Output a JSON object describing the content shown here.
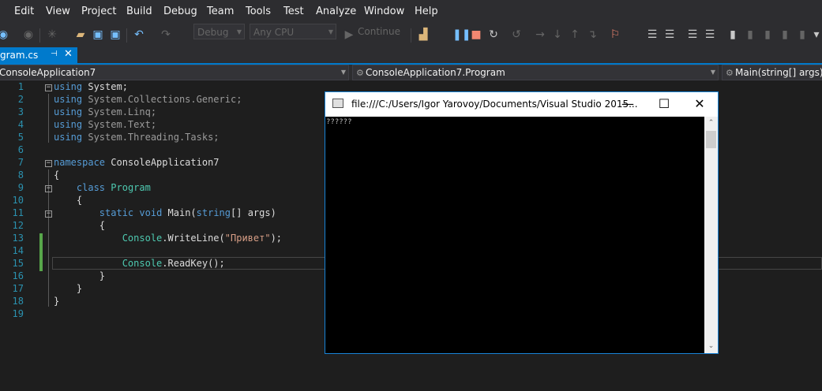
{
  "menu": [
    "Edit",
    "View",
    "Project",
    "Build",
    "Debug",
    "Team",
    "Tools",
    "Test",
    "Analyze",
    "Window",
    "Help"
  ],
  "toolbar": {
    "config": "Debug",
    "platform": "Any CPU",
    "continue_label": "Continue"
  },
  "tab": {
    "label": "gram.cs",
    "pin_icon": "pin-icon",
    "close_icon": "close-icon"
  },
  "nav": {
    "project": "ConsoleApplication7",
    "class": "ConsoleApplication7.Program",
    "member": "Main(string[] args)"
  },
  "editor": {
    "line_numbers": [
      "1",
      "2",
      "3",
      "4",
      "5",
      "6",
      "7",
      "8",
      "9",
      "10",
      "11",
      "12",
      "13",
      "14",
      "15",
      "16",
      "17",
      "18",
      "19"
    ],
    "lines": [
      {
        "indent": "",
        "tokens": [
          {
            "t": "using",
            "c": "kw"
          },
          {
            "t": " System;",
            "c": "pl"
          }
        ]
      },
      {
        "indent": "",
        "tokens": [
          {
            "t": "using",
            "c": "kw"
          },
          {
            "t": " System.Collections.Generic;",
            "c": "gray"
          }
        ]
      },
      {
        "indent": "",
        "tokens": [
          {
            "t": "using",
            "c": "kw"
          },
          {
            "t": " System.Linq;",
            "c": "gray"
          }
        ]
      },
      {
        "indent": "",
        "tokens": [
          {
            "t": "using",
            "c": "kw"
          },
          {
            "t": " System.Text;",
            "c": "gray"
          }
        ]
      },
      {
        "indent": "",
        "tokens": [
          {
            "t": "using",
            "c": "kw"
          },
          {
            "t": " System.Threading.Tasks;",
            "c": "gray"
          }
        ]
      },
      {
        "indent": "",
        "tokens": []
      },
      {
        "indent": "",
        "tokens": [
          {
            "t": "namespace",
            "c": "kw"
          },
          {
            "t": " ConsoleApplication7",
            "c": "pl"
          }
        ]
      },
      {
        "indent": "",
        "tokens": [
          {
            "t": "{",
            "c": "pl"
          }
        ]
      },
      {
        "indent": "    ",
        "tokens": [
          {
            "t": "class",
            "c": "kw"
          },
          {
            "t": " ",
            "c": "pl"
          },
          {
            "t": "Program",
            "c": "ty"
          }
        ]
      },
      {
        "indent": "    ",
        "tokens": [
          {
            "t": "{",
            "c": "pl"
          }
        ]
      },
      {
        "indent": "        ",
        "tokens": [
          {
            "t": "static",
            "c": "kw"
          },
          {
            "t": " ",
            "c": "pl"
          },
          {
            "t": "void",
            "c": "kw"
          },
          {
            "t": " Main(",
            "c": "pl"
          },
          {
            "t": "string",
            "c": "kw"
          },
          {
            "t": "[] args)",
            "c": "pl"
          }
        ]
      },
      {
        "indent": "        ",
        "tokens": [
          {
            "t": "{",
            "c": "pl"
          }
        ]
      },
      {
        "indent": "            ",
        "tokens": [
          {
            "t": "Console",
            "c": "ty"
          },
          {
            "t": ".WriteLine(",
            "c": "pl"
          },
          {
            "t": "\"Привет\"",
            "c": "str"
          },
          {
            "t": ");",
            "c": "pl"
          }
        ]
      },
      {
        "indent": "",
        "tokens": []
      },
      {
        "indent": "            ",
        "tokens": [
          {
            "t": "Console",
            "c": "ty"
          },
          {
            "t": ".ReadKey();",
            "c": "pl"
          }
        ]
      },
      {
        "indent": "        ",
        "tokens": [
          {
            "t": "}",
            "c": "pl"
          }
        ]
      },
      {
        "indent": "    ",
        "tokens": [
          {
            "t": "}",
            "c": "pl"
          }
        ]
      },
      {
        "indent": "",
        "tokens": [
          {
            "t": "}",
            "c": "pl"
          }
        ]
      },
      {
        "indent": "",
        "tokens": []
      }
    ]
  },
  "console": {
    "title": "file:///C:/Users/Igor Yarovoy/Documents/Visual Studio 2015...",
    "output": "??????",
    "minimize": "—",
    "maximize": "☐",
    "close": "✕"
  }
}
